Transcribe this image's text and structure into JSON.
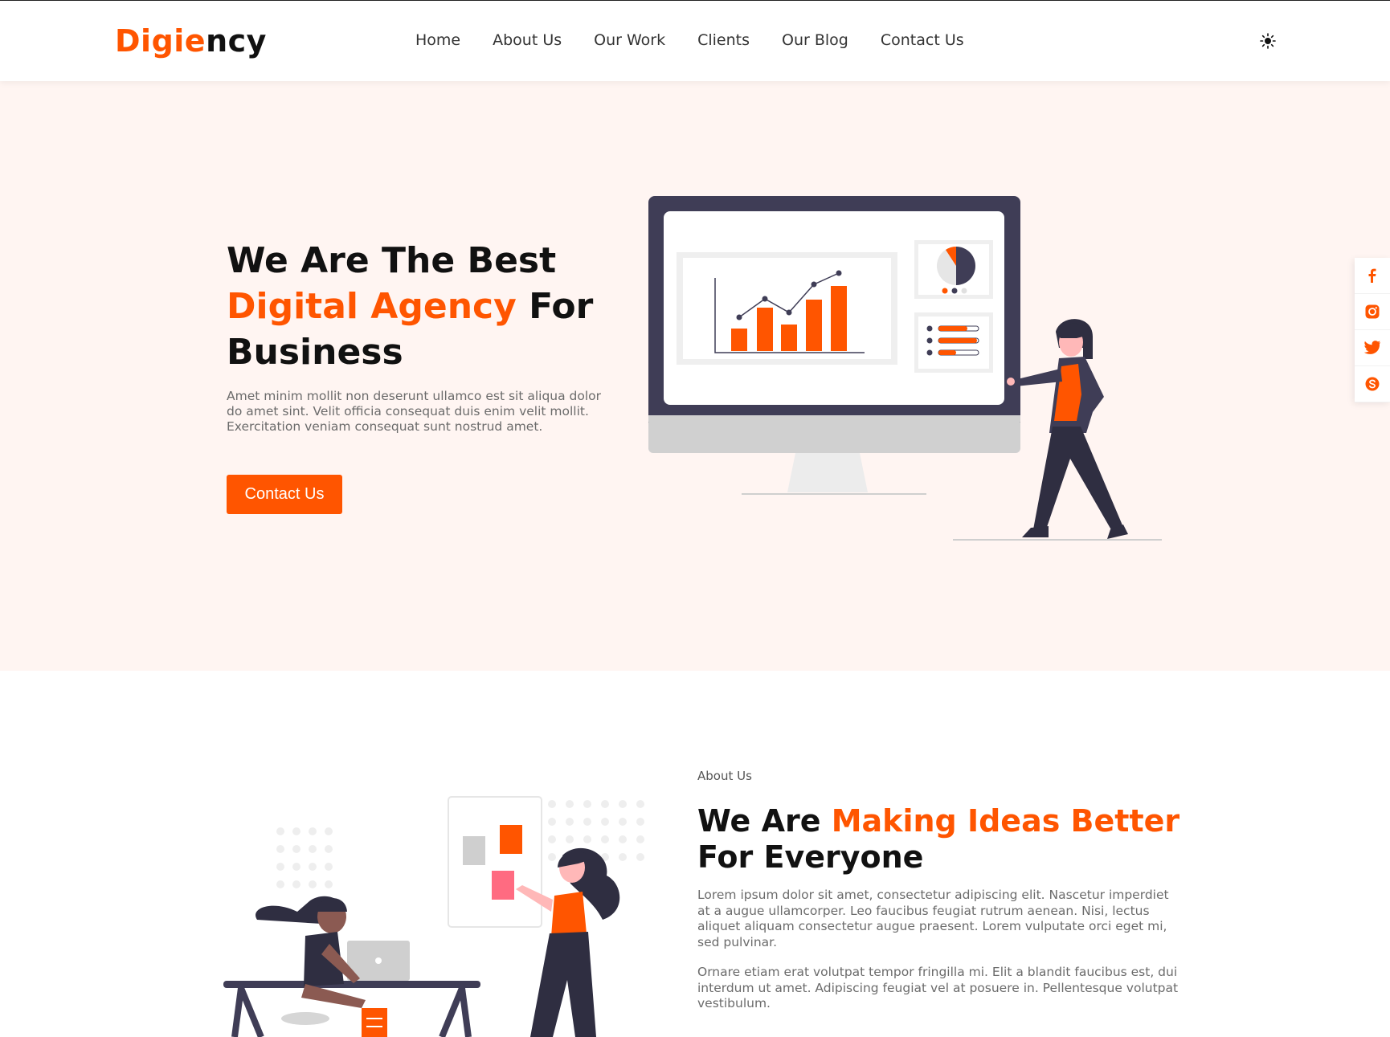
{
  "header": {
    "logo_part1": "Digie",
    "logo_part2": "ncy",
    "nav": [
      "Home",
      "About Us",
      "Our Work",
      "Clients",
      "Our Blog",
      "Contact Us"
    ],
    "theme_toggle_icon": "sun-icon"
  },
  "hero": {
    "title_line1": "We Are The Best",
    "title_highlight": "Digital Agency",
    "title_line2_rest": " For",
    "title_line3": "Business",
    "description": "Amet minim mollit non deserunt ullamco est sit aliqua dolor do amet sint. Velit officia consequat duis enim velit mollit. Exercitation veniam consequat sunt nostrud amet.",
    "cta_label": "Contact Us"
  },
  "social": [
    "facebook-icon",
    "instagram-icon",
    "twitter-icon",
    "skype-icon"
  ],
  "about": {
    "eyebrow": "About Us",
    "title_part1": "We Are ",
    "title_highlight": "Making Ideas Better",
    "title_part2": " For Everyone",
    "paragraph1": "Lorem ipsum dolor sit amet, consectetur adipiscing elit. Nascetur imperdiet at a augue ullamcorper. Leo faucibus feugiat rutrum aenean. Nisi, lectus aliquet aliquam consectetur augue praesent. Lorem vulputate orci eget mi, sed pulvinar.",
    "paragraph2": "Ornare etiam erat volutpat tempor fringilla mi. Elit a blandit faucibus est, dui interdum ut amet. Adipiscing feugiat vel at posuere in. Pellentesque volutpat vestibulum."
  },
  "colors": {
    "accent": "#ff5500",
    "hero_bg": "#fff5f2",
    "dark": "#3f3d56"
  }
}
